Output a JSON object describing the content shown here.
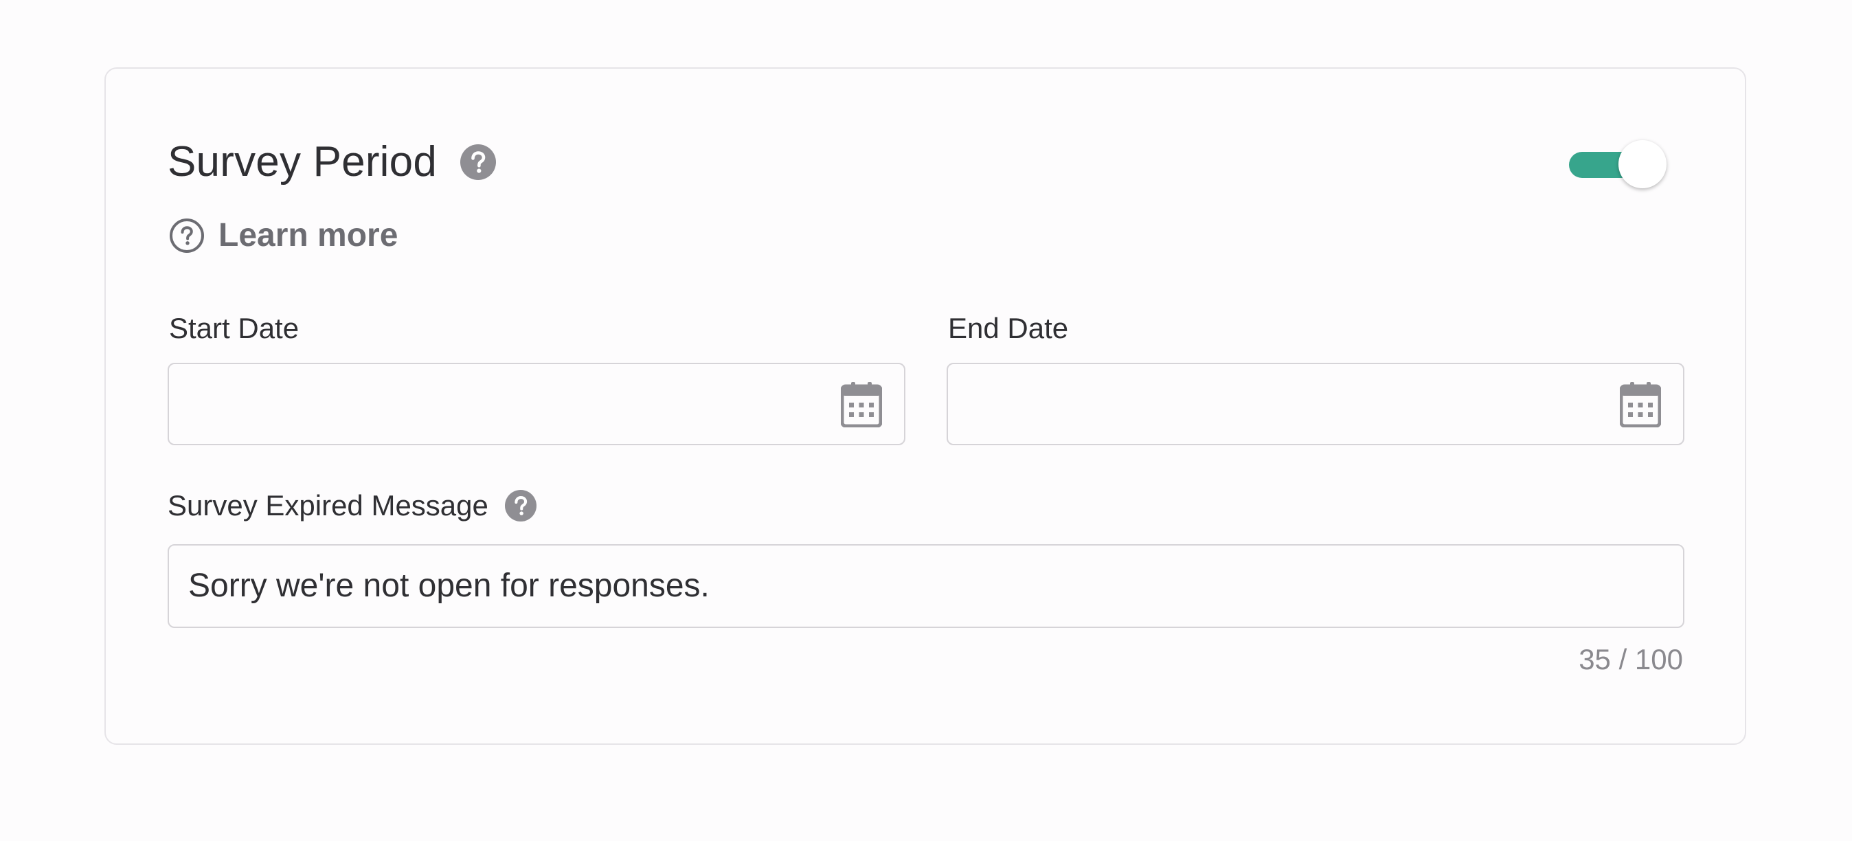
{
  "section": {
    "title": "Survey Period",
    "title_help_icon": "help-circle-filled-icon",
    "toggle_on": true,
    "toggle_color": "#37a58c",
    "learn_more_icon": "help-circle-outline-icon",
    "learn_more_label": "Learn more"
  },
  "start_date": {
    "label": "Start Date",
    "value": "",
    "icon": "calendar-icon"
  },
  "end_date": {
    "label": "End Date",
    "value": "",
    "icon": "calendar-icon"
  },
  "expired_message": {
    "label": "Survey Expired Message",
    "help_icon": "help-circle-filled-icon",
    "value": "Sorry we're not open for responses.",
    "counter": "35 / 100"
  }
}
